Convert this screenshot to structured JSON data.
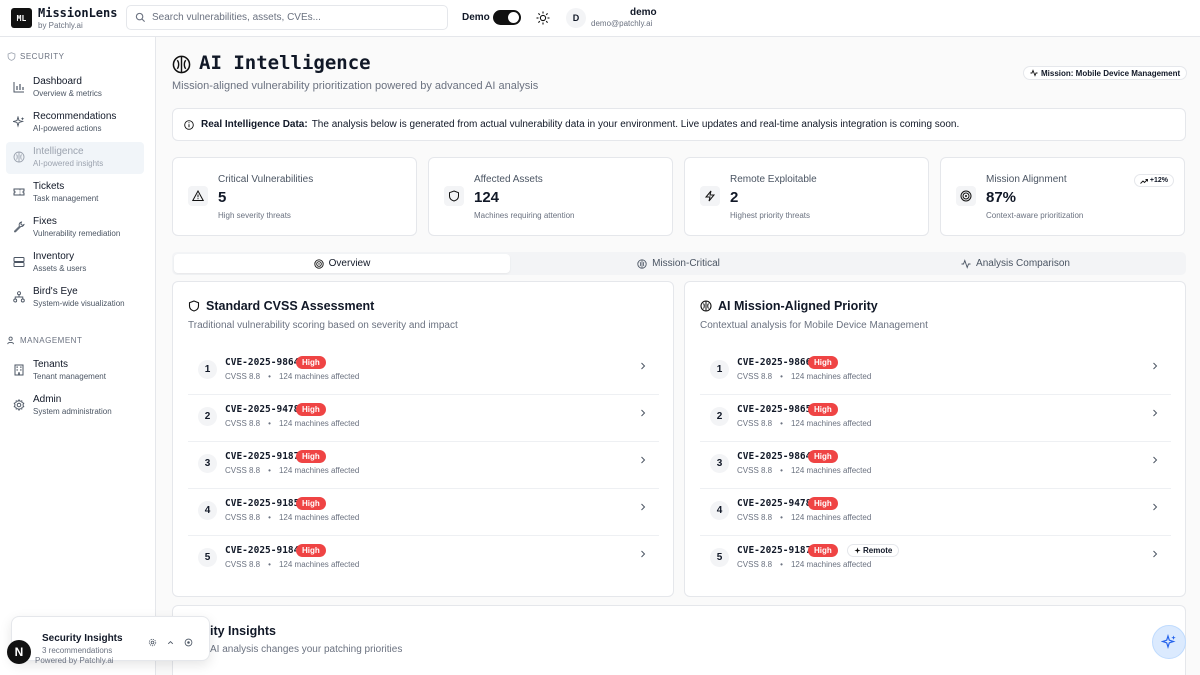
{
  "app": {
    "logo": "ML",
    "name": "MissionLens",
    "by": "by Patchly.ai"
  },
  "search": {
    "placeholder": "Search vulnerabilities, assets, CVEs..."
  },
  "demo": {
    "label": "Demo",
    "enabled": true
  },
  "user": {
    "initial": "D",
    "name": "demo",
    "email": "demo@patchly.ai"
  },
  "sidebar": {
    "security_heading": "SECURITY",
    "management_heading": "MANAGEMENT",
    "items": [
      {
        "label": "Dashboard",
        "sub": "Overview & metrics",
        "icon": "bar-chart-icon"
      },
      {
        "label": "Recommendations",
        "sub": "AI-powered actions",
        "icon": "sparkles-icon"
      },
      {
        "label": "Intelligence",
        "sub": "AI-powered insights",
        "icon": "brain-icon",
        "active": true
      },
      {
        "label": "Tickets",
        "sub": "Task management",
        "icon": "ticket-icon"
      },
      {
        "label": "Fixes",
        "sub": "Vulnerability remediation",
        "icon": "wrench-icon"
      },
      {
        "label": "Inventory",
        "sub": "Assets & users",
        "icon": "server-icon"
      },
      {
        "label": "Bird's Eye",
        "sub": "System-wide visualization",
        "icon": "network-icon"
      },
      {
        "label": "Tenants",
        "sub": "Tenant management",
        "icon": "building-icon"
      },
      {
        "label": "Admin",
        "sub": "System administration",
        "icon": "gear-icon"
      }
    ]
  },
  "page": {
    "title": "AI Intelligence",
    "subtitle": "Mission-aligned vulnerability prioritization powered by advanced AI analysis",
    "mission": "Mission: Mobile Device Management"
  },
  "notice": {
    "bold": "Real Intelligence Data:",
    "text": "The analysis below is generated from actual vulnerability data in your environment. Live updates and real-time analysis integration is coming soon."
  },
  "stats": [
    {
      "label": "Critical Vulnerabilities",
      "value": "5",
      "desc": "High severity threats",
      "icon": "alert-triangle-icon"
    },
    {
      "label": "Affected Assets",
      "value": "124",
      "desc": "Machines requiring attention",
      "icon": "shield-icon"
    },
    {
      "label": "Remote Exploitable",
      "value": "2",
      "desc": "Highest priority threats",
      "icon": "zap-icon"
    },
    {
      "label": "Mission Alignment",
      "value": "87%",
      "desc": "Context-aware prioritization",
      "icon": "target-icon",
      "trend": "+12%"
    }
  ],
  "tabs": [
    {
      "label": "Overview",
      "active": true
    },
    {
      "label": "Mission-Critical"
    },
    {
      "label": "Analysis Comparison"
    }
  ],
  "standard": {
    "title": "Standard CVSS Assessment",
    "subtitle": "Traditional vulnerability scoring based on severity and impact",
    "rows": [
      {
        "rank": "1",
        "cve": "CVE-2025-9864",
        "severity": "High",
        "cvss": "CVSS 8.8",
        "machines": "124 machines affected"
      },
      {
        "rank": "2",
        "cve": "CVE-2025-9478",
        "severity": "High",
        "cvss": "CVSS 8.8",
        "machines": "124 machines affected"
      },
      {
        "rank": "3",
        "cve": "CVE-2025-9187",
        "severity": "High",
        "cvss": "CVSS 8.8",
        "machines": "124 machines affected"
      },
      {
        "rank": "4",
        "cve": "CVE-2025-9185",
        "severity": "High",
        "cvss": "CVSS 8.8",
        "machines": "124 machines affected"
      },
      {
        "rank": "5",
        "cve": "CVE-2025-9184",
        "severity": "High",
        "cvss": "CVSS 8.8",
        "machines": "124 machines affected"
      }
    ]
  },
  "ai": {
    "title": "AI Mission-Aligned Priority",
    "subtitle": "Contextual analysis for Mobile Device Management",
    "rows": [
      {
        "rank": "1",
        "cve": "CVE-2025-9866",
        "severity": "High",
        "cvss": "CVSS 8.8",
        "machines": "124 machines affected"
      },
      {
        "rank": "2",
        "cve": "CVE-2025-9865",
        "severity": "High",
        "cvss": "CVSS 8.8",
        "machines": "124 machines affected"
      },
      {
        "rank": "3",
        "cve": "CVE-2025-9864",
        "severity": "High",
        "cvss": "CVSS 8.8",
        "machines": "124 machines affected"
      },
      {
        "rank": "4",
        "cve": "CVE-2025-9478",
        "severity": "High",
        "cvss": "CVSS 8.8",
        "machines": "124 machines affected"
      },
      {
        "rank": "5",
        "cve": "CVE-2025-9187",
        "severity": "High",
        "cvss": "CVSS 8.8",
        "machines": "124 machines affected",
        "tag": "Remote"
      }
    ]
  },
  "insights": {
    "title": "ity Insights",
    "subtitle": "AI analysis changes your patching priorities"
  },
  "toast": {
    "title": "Security Insights",
    "sub": "3 recommendations",
    "powered": "Powered by Patchly.ai"
  },
  "n_button": "N",
  "colors": {
    "high": "#ef4444",
    "active_nav": "#f1f5f9"
  }
}
